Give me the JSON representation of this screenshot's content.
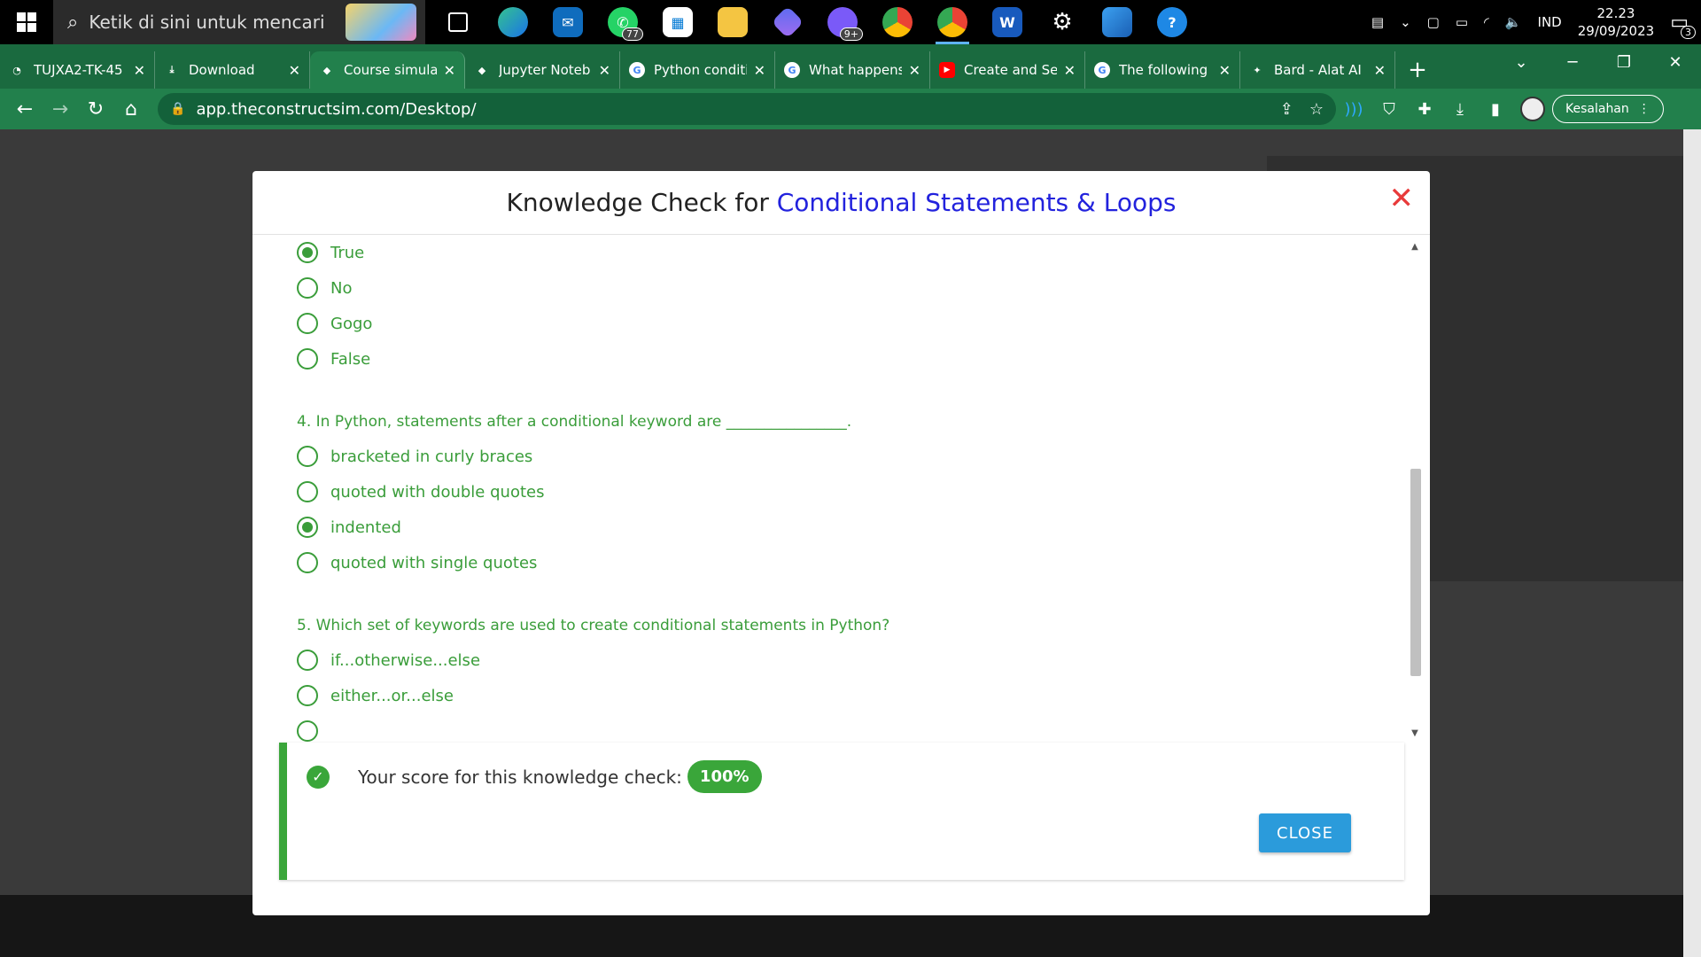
{
  "taskbar": {
    "search_placeholder": "Ketik di sini untuk mencari",
    "whatsapp_badge": "77",
    "messenger_badge": "9+",
    "language": "IND",
    "time": "22.23",
    "date": "29/09/2023",
    "notifications": "3"
  },
  "tabs": [
    {
      "label": "TUJXA2-TK-45",
      "fav": "ghost",
      "color": "#444"
    },
    {
      "label": "Download",
      "fav": "download",
      "color": "#1a6a3f"
    },
    {
      "label": "Course simula",
      "fav": "construct",
      "color": "#4a6cd4",
      "active": true
    },
    {
      "label": "Jupyter Noteb",
      "fav": "construct",
      "color": "#4a6cd4"
    },
    {
      "label": "Python conditi",
      "fav": "google",
      "color": "#fff"
    },
    {
      "label": "What happens",
      "fav": "google",
      "color": "#fff"
    },
    {
      "label": "Create and Se",
      "fav": "youtube",
      "color": "#f00"
    },
    {
      "label": "The following",
      "fav": "google",
      "color": "#fff"
    },
    {
      "label": "Bard - Alat AI",
      "fav": "bard",
      "color": "#7b6bf0"
    }
  ],
  "toolbar": {
    "url_host": "app.theconstructsim.com",
    "url_path": "/Desktop/",
    "error_label": "Kesalahan"
  },
  "modal": {
    "title_prefix": "Knowledge Check for ",
    "title_highlight": "Conditional Statements & Loops",
    "q3_options": [
      {
        "label": "True",
        "selected": true
      },
      {
        "label": "No",
        "selected": false
      },
      {
        "label": "Gogo",
        "selected": false
      },
      {
        "label": "False",
        "selected": false
      }
    ],
    "q4": {
      "text": "4. In Python, statements after a conditional keyword are ________________.",
      "options": [
        {
          "label": "bracketed in curly braces",
          "selected": false
        },
        {
          "label": "quoted with double quotes",
          "selected": false
        },
        {
          "label": "indented",
          "selected": true
        },
        {
          "label": "quoted with single quotes",
          "selected": false
        }
      ]
    },
    "q5": {
      "text": "5. Which set of keywords are used to create conditional statements in Python?",
      "options": [
        {
          "label": "if...otherwise...else",
          "selected": false
        },
        {
          "label": "either...or...else",
          "selected": false
        }
      ]
    },
    "score_text": "Your score for this knowledge check:",
    "score_value": "100%",
    "close_label": "CLOSE"
  }
}
